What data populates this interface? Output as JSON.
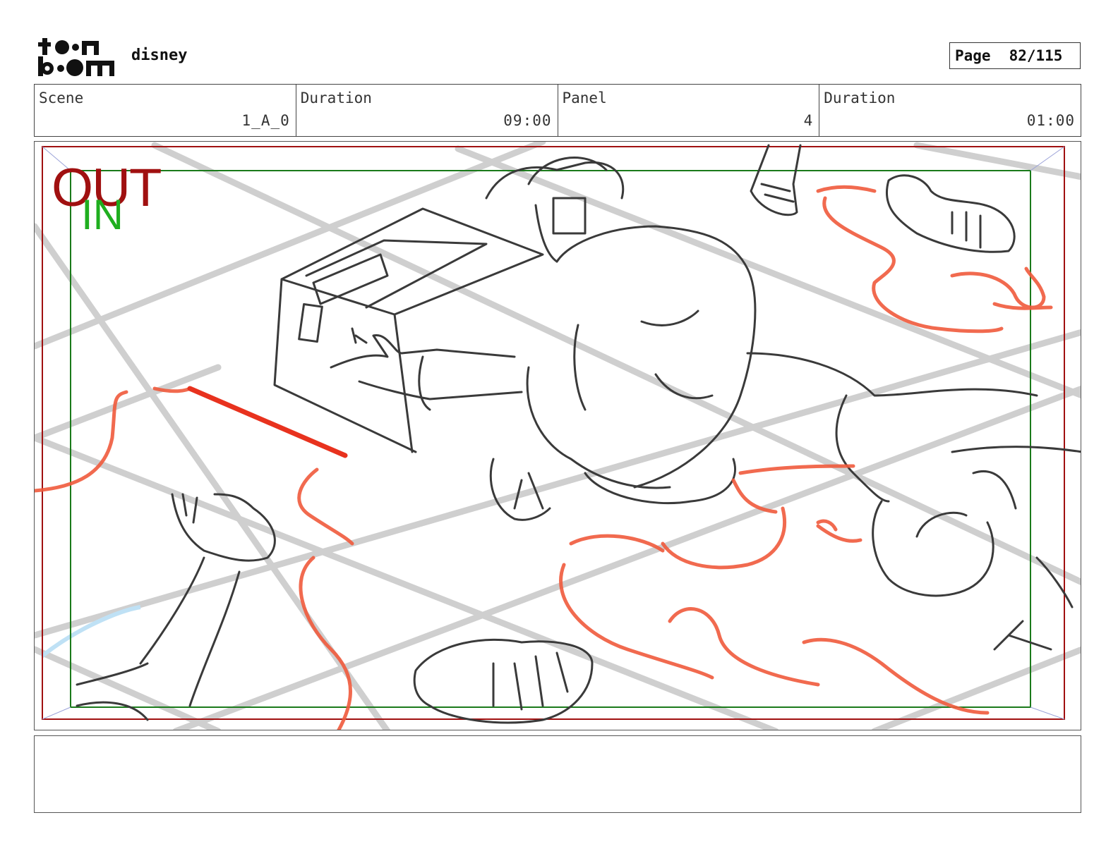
{
  "header": {
    "logo_text": "toon boom",
    "project": "disney",
    "page_label": "Page",
    "page_value": "82/115"
  },
  "info": {
    "scene_label": "Scene",
    "scene_value": "1_A_0",
    "duration_label": "Duration",
    "duration_value": "09:00",
    "panel_label": "Panel",
    "panel_value": "4",
    "panel_duration_label": "Duration",
    "panel_duration_value": "01:00"
  },
  "panel": {
    "out_label": "OUT",
    "in_label": "IN",
    "out_frame_color": "#a01010",
    "in_frame_color": "#1a7a1a",
    "sketch_color": "#333333",
    "accent_color": "#f05a3c",
    "grid_color": "#cccccc"
  },
  "notes": {
    "text": ""
  }
}
